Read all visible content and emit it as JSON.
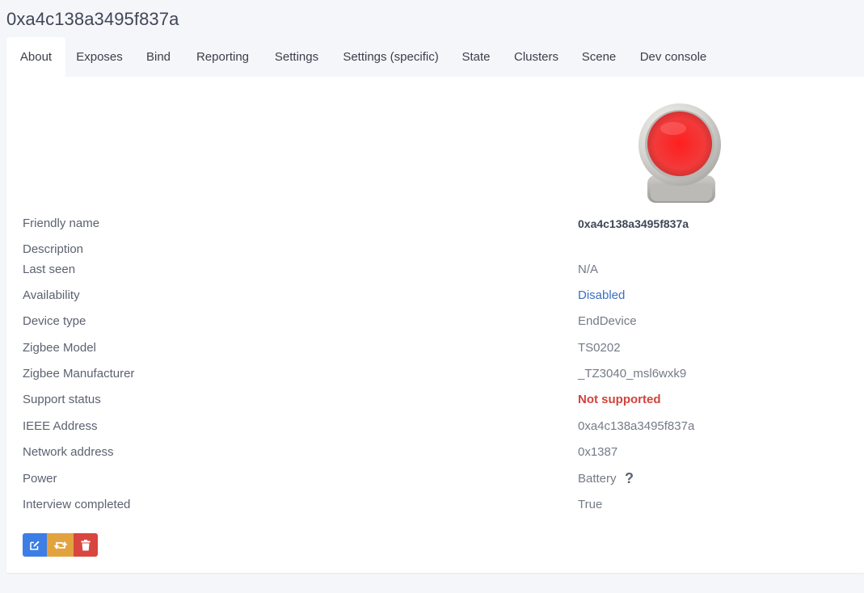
{
  "page": {
    "title": "0xa4c138a3495f837a"
  },
  "tabs": [
    {
      "label": "About",
      "active": true
    },
    {
      "label": "Exposes"
    },
    {
      "label": "Bind"
    },
    {
      "label": "Reporting"
    },
    {
      "label": "Settings"
    },
    {
      "label": "Settings (specific)"
    },
    {
      "label": "State"
    },
    {
      "label": "Clusters"
    },
    {
      "label": "Scene"
    },
    {
      "label": "Dev console"
    }
  ],
  "device_image": {
    "icon": "red-button-device-icon",
    "colors": {
      "button": "#ff1f1f",
      "body": "#d8d6d2"
    }
  },
  "rows": [
    {
      "label": "Friendly name",
      "value": "0xa4c138a3495f837a"
    },
    {
      "label": "Description",
      "value": ""
    },
    {
      "label": "Last seen",
      "value": "N/A"
    },
    {
      "label": "Availability",
      "value": "Disabled"
    },
    {
      "label": "Device type",
      "value": "EndDevice"
    },
    {
      "label": "Zigbee Model",
      "value": "TS0202"
    },
    {
      "label": "Zigbee Manufacturer",
      "value": "_TZ3040_msl6wxk9"
    },
    {
      "label": "Support status",
      "value": "Not supported"
    },
    {
      "label": "IEEE Address",
      "value": "0xa4c138a3495f837a"
    },
    {
      "label": "Network address",
      "value": "0x1387"
    },
    {
      "label": "Power",
      "value": "Battery",
      "help": "?"
    },
    {
      "label": "Interview completed",
      "value": "True"
    }
  ],
  "actions": [
    {
      "name": "edit",
      "icon": "edit-icon",
      "color": "#3c7ee6"
    },
    {
      "name": "interview",
      "icon": "refresh-icon",
      "color": "#e2a33f"
    },
    {
      "name": "remove",
      "icon": "trash-icon",
      "color": "#d9463f"
    }
  ],
  "colors": {
    "link": "#3b6fc4",
    "danger": "#d0443c",
    "background": "#f5f6fa"
  }
}
